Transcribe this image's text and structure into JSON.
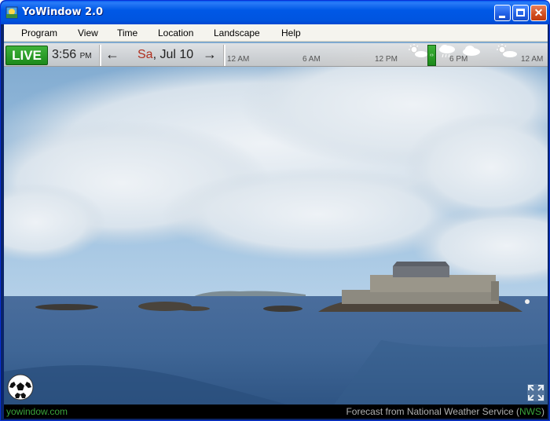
{
  "window": {
    "title": "YoWindow 2.0"
  },
  "menu": {
    "items": [
      "Program",
      "View",
      "Time",
      "Location",
      "Landscape",
      "Help"
    ]
  },
  "timeline": {
    "live_label": "LIVE",
    "time": "3:56",
    "ampm": "PM",
    "prev_arrow": "←",
    "next_arrow": "→",
    "day": "Sa",
    "date": ", Jul 10",
    "hour_labels": [
      "12 AM",
      "6 AM",
      "12 PM",
      "6 PM",
      "12 AM"
    ],
    "handle_glyph": "‹›"
  },
  "footer": {
    "site": "yowindow.com",
    "forecast_prefix": "Forecast from National Weather Service (",
    "forecast_source": "NWS",
    "forecast_suffix": ")"
  },
  "colors": {
    "live_green": "#1c8a1a",
    "footer_green": "#3aa33a",
    "day_red": "#b03020",
    "titlebar_blue": "#0058e6"
  },
  "icons": {
    "app": "yowindow-app-icon",
    "weather": [
      "sun-cloud-icon",
      "rain-cloud-icon",
      "cloud-icon",
      "sun-cloud-icon"
    ],
    "ball": "soccer-ball-icon",
    "expand": "fullscreen-icon"
  }
}
